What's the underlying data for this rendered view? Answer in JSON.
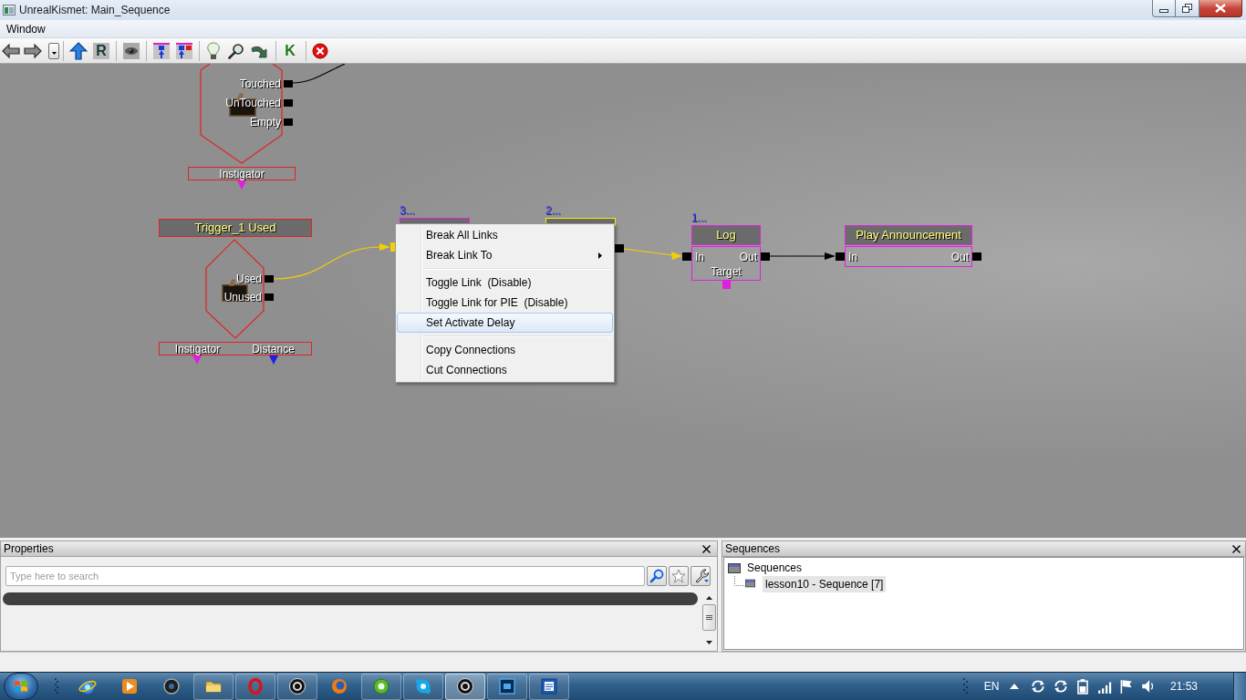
{
  "window": {
    "title": "UnrealKismet: Main_Sequence"
  },
  "menu_bar": [
    "Window"
  ],
  "toolbar": {
    "letter_buttons": [
      "R",
      "K"
    ]
  },
  "canvas": {
    "event_nodes": [
      {
        "selected": false,
        "outputs": [
          "Touched",
          "UnTouched",
          "Empty"
        ],
        "variables": [
          {
            "label": "Instigator",
            "color": "#e020e0"
          }
        ]
      },
      {
        "title": "Trigger_1 Used",
        "selected": false,
        "outputs": [
          "Used",
          "Unused"
        ],
        "variables": [
          {
            "label": "Instigator",
            "color": "#e020e0"
          },
          {
            "label": "Distance",
            "color": "#2020e0"
          }
        ]
      }
    ],
    "action_nodes": [
      {
        "comment": "3...",
        "selected": false,
        "inputs": [
          {
            "selected": true
          }
        ]
      },
      {
        "comment": "2...",
        "selected": true,
        "outputs": [
          {
            "selected": false
          }
        ]
      },
      {
        "comment": "1...",
        "title": "Log",
        "selected": false,
        "inputs": [
          {
            "label": "In",
            "selected": false
          }
        ],
        "outputs": [
          {
            "label": "Out",
            "selected": false
          }
        ],
        "variables": [
          {
            "label": "Target",
            "color": "#e020e0"
          }
        ]
      },
      {
        "title": "Play Announcement",
        "selected": false,
        "inputs": [
          {
            "label": "In",
            "selected": false
          }
        ],
        "outputs": [
          {
            "label": "Out",
            "selected": false
          }
        ]
      }
    ],
    "wires": [
      {
        "highlighted": false
      },
      {
        "highlighted": true
      },
      {
        "highlighted": true
      },
      {
        "highlighted": false
      }
    ],
    "context_menu": {
      "groups": [
        [
          {
            "label": "Break All Links",
            "submenu": false,
            "selected": false
          },
          {
            "label": "Break Link To",
            "submenu": true,
            "selected": false
          }
        ],
        [
          {
            "label": "Toggle Link  (Disable)",
            "submenu": false,
            "selected": false
          },
          {
            "label": "Toggle Link for PIE  (Disable)",
            "submenu": false,
            "selected": false
          },
          {
            "label": "Set Activate Delay",
            "submenu": false,
            "selected": true
          }
        ],
        [
          {
            "label": "Copy Connections",
            "submenu": false,
            "selected": false
          },
          {
            "label": "Cut Connections",
            "submenu": false,
            "selected": false
          }
        ]
      ]
    }
  },
  "properties_panel": {
    "title": "Properties",
    "search": {
      "placeholder": "Type here to search"
    }
  },
  "sequences_panel": {
    "title": "Sequences",
    "tree": [
      {
        "label": "Sequences",
        "selected": false,
        "children": [
          {
            "label": "lesson10 - Sequence [7]",
            "selected": true
          }
        ]
      }
    ]
  },
  "taskbar": {
    "apps": [
      {
        "running": false,
        "selected": false
      },
      {
        "running": false,
        "selected": false
      },
      {
        "running": false,
        "selected": false
      },
      {
        "running": true,
        "selected": false
      },
      {
        "running": true,
        "selected": false
      },
      {
        "running": true,
        "selected": false
      },
      {
        "running": false,
        "selected": false
      },
      {
        "running": true,
        "selected": false
      },
      {
        "running": true,
        "selected": false
      },
      {
        "running": true,
        "selected": true
      },
      {
        "running": true,
        "selected": false
      },
      {
        "running": true,
        "selected": false
      }
    ],
    "language": "EN",
    "clock": "21:53"
  }
}
